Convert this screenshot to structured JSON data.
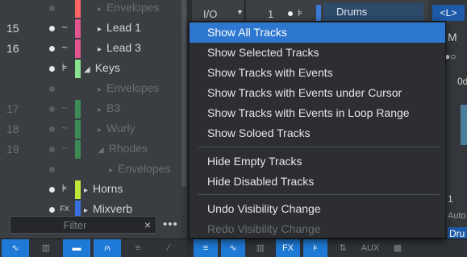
{
  "tracks": [
    {
      "num": "",
      "label": "Envelopes",
      "kind": "envelope",
      "color": "#ff6666",
      "dim": true,
      "expander": "▸",
      "indent": 121
    },
    {
      "num": "15",
      "label": "Lead 1",
      "kind": "audio",
      "color": "#e0568d",
      "dim": false,
      "expander": "▸",
      "indent": 121,
      "icon": "~"
    },
    {
      "num": "16",
      "label": "Lead 3",
      "kind": "audio",
      "color": "#e0568d",
      "dim": false,
      "expander": "▸",
      "indent": 121,
      "icon": "~"
    },
    {
      "num": "",
      "label": "Keys",
      "kind": "folder",
      "color": "#8be28e",
      "dim": false,
      "expander": "◢",
      "indent": 104,
      "icon": "⊧"
    },
    {
      "num": "",
      "label": "Envelopes",
      "kind": "envelope",
      "color": "",
      "dim": true,
      "expander": "▸",
      "indent": 121
    },
    {
      "num": "17",
      "label": "B3",
      "kind": "audio",
      "color": "#3d8a55",
      "dim": true,
      "expander": "▸",
      "indent": 121,
      "icon": "~"
    },
    {
      "num": "18",
      "label": "Wurly",
      "kind": "audio",
      "color": "#3d8a55",
      "dim": true,
      "expander": "▸",
      "indent": 121,
      "icon": "~"
    },
    {
      "num": "19",
      "label": "Rhodes",
      "kind": "audio",
      "color": "#3d8a55",
      "dim": true,
      "expander": "◢",
      "indent": 121,
      "icon": "~"
    },
    {
      "num": "",
      "label": "Envelopes",
      "kind": "envelope",
      "color": "",
      "dim": true,
      "expander": "▸",
      "indent": 135
    },
    {
      "num": "",
      "label": "Horns",
      "kind": "folder",
      "color": "#bfe83a",
      "dim": false,
      "expander": "▸",
      "indent": 104,
      "icon": "⊧"
    },
    {
      "num": "",
      "label": "Mixverb",
      "kind": "fx",
      "color": "#3a6fe0",
      "dim": false,
      "expander": "▸",
      "indent": 104,
      "icon": "FX"
    }
  ],
  "filter": {
    "placeholder": "Filter",
    "clear": "×",
    "more": "•••"
  },
  "track_strip": {
    "io": "I/O",
    "io_arrow": "▼",
    "num": "1",
    "icon": "⊧",
    "name": "Drums"
  },
  "side": {
    "l_button": "<L>",
    "m": "M",
    "toggle": "●○",
    "od": "0d",
    "one": "1",
    "auto": "Auto",
    "dru": "Dru"
  },
  "menu": {
    "items": [
      {
        "label": "Show All Tracks",
        "highlighted": true,
        "disabled": false
      },
      {
        "label": "Show Selected Tracks",
        "highlighted": false,
        "disabled": false
      },
      {
        "label": "Show Tracks with Events",
        "highlighted": false,
        "disabled": false
      },
      {
        "label": "Show Tracks with Events under Cursor",
        "highlighted": false,
        "disabled": false
      },
      {
        "label": "Show Tracks with Events in Loop Range",
        "highlighted": false,
        "disabled": false
      },
      {
        "label": "Show Soloed Tracks",
        "highlighted": false,
        "disabled": false
      },
      {
        "label": "Hide Empty Tracks",
        "highlighted": false,
        "disabled": false
      },
      {
        "label": "Hide Disabled Tracks",
        "highlighted": false,
        "disabled": false
      },
      {
        "label": "Undo Visibility Change",
        "highlighted": false,
        "disabled": false
      },
      {
        "label": "Redo Visibility Change",
        "highlighted": false,
        "disabled": true
      }
    ]
  },
  "left_toolbar": [
    {
      "icon": "waveform-icon",
      "glyph": "∿",
      "active": true
    },
    {
      "icon": "keyboard-icon",
      "glyph": "▥",
      "active": false
    },
    {
      "icon": "folder-icon",
      "glyph": "▬",
      "active": true
    },
    {
      "icon": "automation-icon",
      "glyph": "⩀",
      "active": true
    },
    {
      "icon": "list-icon",
      "glyph": "≡",
      "active": false
    },
    {
      "icon": "curve-icon",
      "glyph": "∕",
      "active": false
    }
  ],
  "right_toolbar": [
    {
      "icon": "list-icon",
      "glyph": "≡",
      "active": true
    },
    {
      "icon": "waveform-icon",
      "glyph": "∿",
      "active": true
    },
    {
      "icon": "keyboard-icon",
      "glyph": "▥",
      "active": false
    },
    {
      "icon": "fx-icon",
      "glyph": "FX",
      "active": true
    },
    {
      "icon": "folder-track-icon",
      "glyph": "⊧",
      "active": true
    },
    {
      "icon": "routing-icon",
      "glyph": "⇅",
      "active": false
    },
    {
      "icon": "aux-icon",
      "glyph": "AUX",
      "active": false
    },
    {
      "icon": "grid-icon",
      "glyph": "▦",
      "active": false
    }
  ],
  "colors": {
    "accent": "#1e7ad6",
    "highlight": "#2e77d0"
  }
}
